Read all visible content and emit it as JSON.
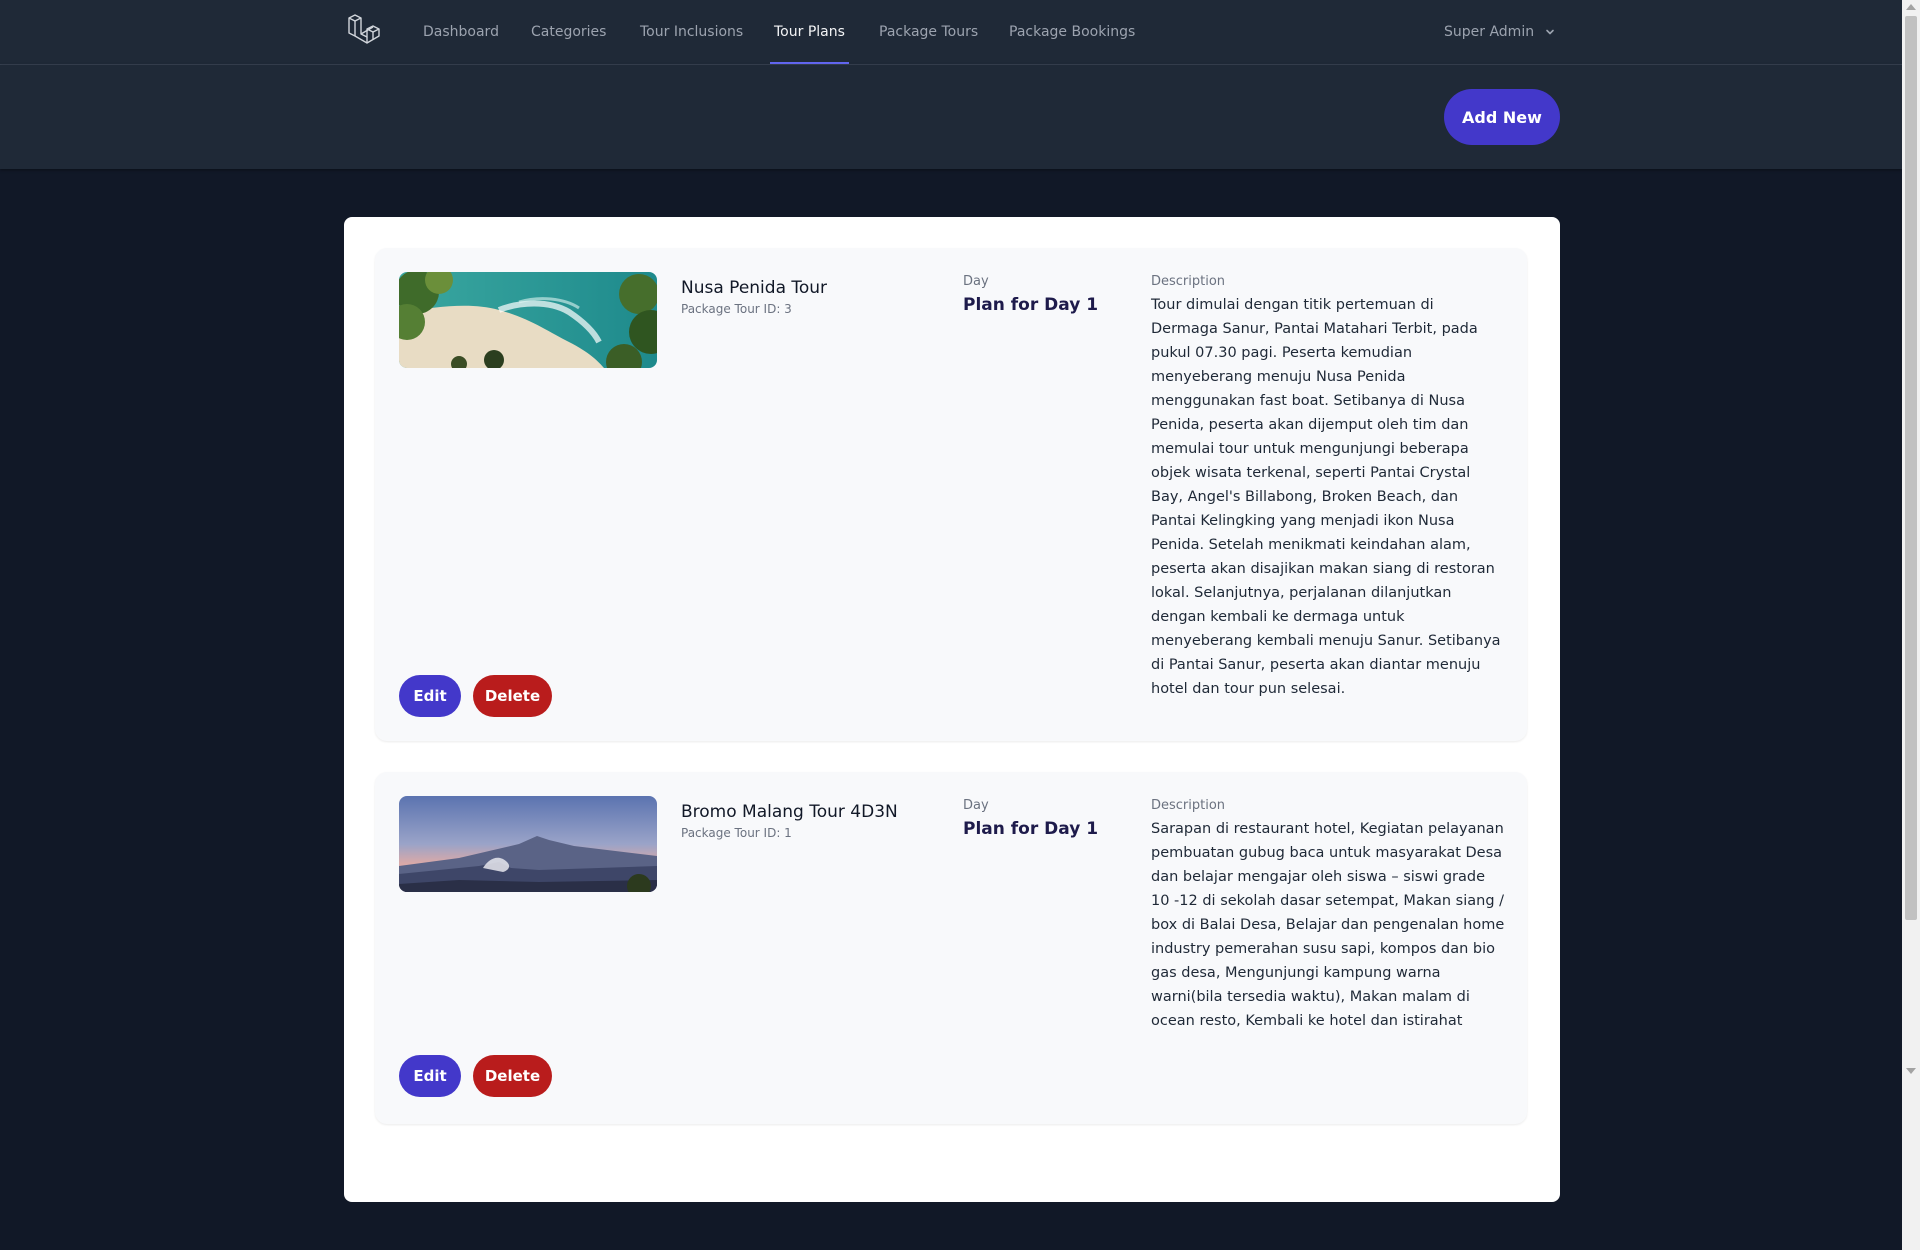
{
  "nav": {
    "items": [
      {
        "label": "Dashboard",
        "active": false
      },
      {
        "label": "Categories",
        "active": false
      },
      {
        "label": "Tour Inclusions",
        "active": false
      },
      {
        "label": "Tour Plans",
        "active": true
      },
      {
        "label": "Package Tours",
        "active": false
      },
      {
        "label": "Package Bookings",
        "active": false
      }
    ],
    "user": "Super Admin",
    "user_icon": "chevron-down-icon",
    "logo_icon": "laravel-logo-icon"
  },
  "header": {
    "add_new_label": "Add New"
  },
  "colors": {
    "primary": "#4338ca",
    "danger": "#b91c1c",
    "active_indicator": "#6366f1"
  },
  "tour_plans": [
    {
      "name": "Nusa Penida Tour",
      "package_id_text": "Package Tour ID: 3",
      "day_label": "Day",
      "day_value": "Plan for Day 1",
      "description_label": "Description",
      "description": "Tour dimulai dengan titik pertemuan di Dermaga Sanur, Pantai Matahari Terbit, pada pukul 07.30 pagi. Peserta kemudian menyeberang menuju Nusa Penida menggunakan fast boat. Setibanya di Nusa Penida, peserta akan dijemput oleh tim dan memulai tour untuk mengunjungi beberapa objek wisata terkenal, seperti Pantai Crystal Bay, Angel's Billabong, Broken Beach, dan Pantai Kelingking yang menjadi ikon Nusa Penida. Setelah menikmati keindahan alam, peserta akan disajikan makan siang di restoran lokal. Selanjutnya, perjalanan dilanjutkan dengan kembali ke dermaga untuk menyeberang kembali menuju Sanur. Setibanya di Pantai Sanur, peserta akan diantar menuju hotel dan tour pun selesai.",
      "edit_label": "Edit",
      "delete_label": "Delete"
    },
    {
      "name": "Bromo Malang Tour 4D3N",
      "package_id_text": "Package Tour ID: 1",
      "day_label": "Day",
      "day_value": "Plan for Day 1",
      "description_label": "Description",
      "description": "Sarapan di restaurant hotel, Kegiatan pelayanan pembuatan gubug baca untuk masyarakat Desa dan belajar mengajar oleh siswa – siswi grade 10 -12 di sekolah dasar setempat, Makan siang / box di Balai Desa, Belajar dan pengenalan home industry pemerahan susu sapi, kompos dan bio gas desa, Mengunjungi kampung warna warni(bila tersedia waktu), Makan malam di ocean resto, Kembali ke hotel dan istirahat",
      "edit_label": "Edit",
      "delete_label": "Delete"
    }
  ]
}
